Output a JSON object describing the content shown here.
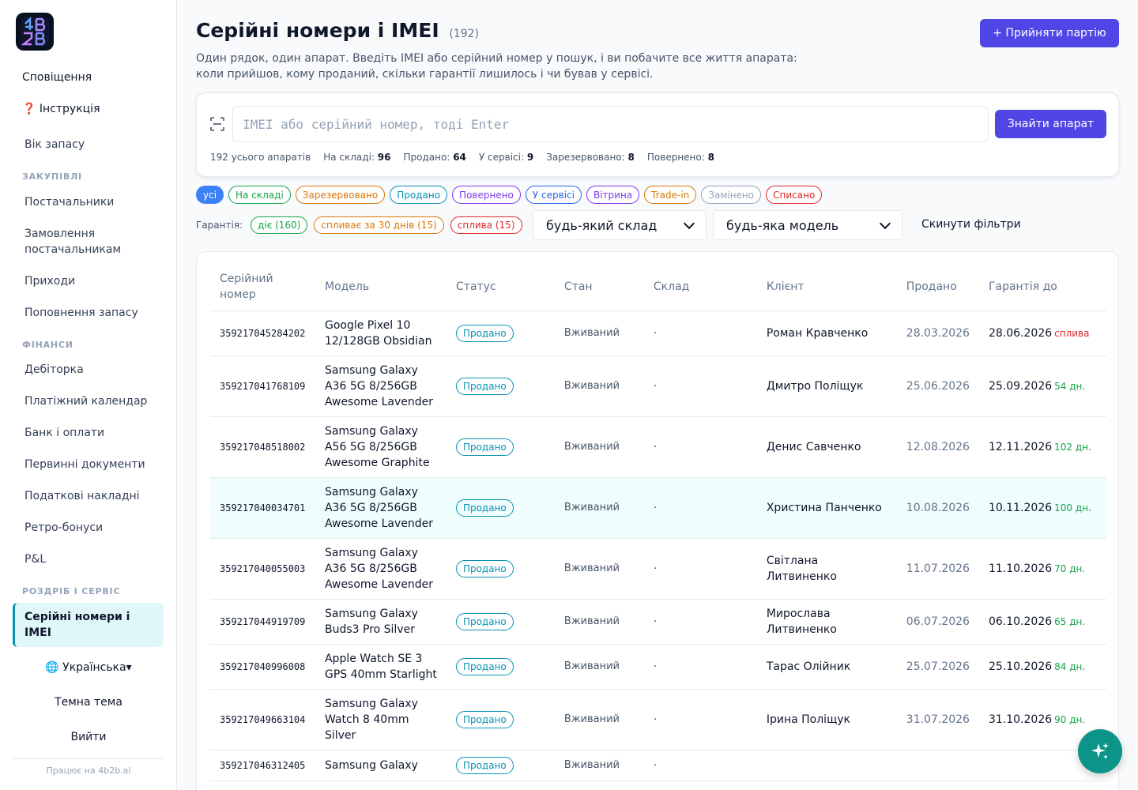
{
  "sidebar": {
    "logo_icon": "4b2b-logo",
    "notifications": "Сповіщення",
    "instructions": "❓ Інструкція",
    "stock_age": "Вік запасу",
    "section_purchases": "ЗАКУПІВЛІ",
    "suppliers": "Постачальники",
    "supplier_orders": "Замовлення постачальникам",
    "receipts": "Приходи",
    "replenishment": "Поповнення запасу",
    "section_finance": "ФІНАНСИ",
    "receivables": "Дебіторка",
    "payment_calendar": "Платіжний календар",
    "bank": "Банк і оплати",
    "documents": "Первинні документи",
    "tax_invoices": "Податкові накладні",
    "retro_bonuses": "Ретро-бонуси",
    "pnl": "P&L",
    "section_retail": "РОЗДРІБ І СЕРВІС",
    "serials_active": "Серійні номери і IMEI",
    "language": "🌐 Українська▾",
    "dark_theme": "Темна тема",
    "logout": "Вийти",
    "powered_by": "Працює на 4b2b.ai"
  },
  "header": {
    "title": "Серійні номери і IMEI",
    "count": "(192)",
    "subtitle_line1": "Один рядок, один апарат. Введіть IMEI або серійний номер у пошук, і ви побачите все життя апарата:",
    "subtitle_line2": "коли прийшов, кому проданий, скільки гарантії лишилось і чи бував у сервісі.",
    "accept_batch": "+ Прийняти партію"
  },
  "search": {
    "placeholder": "IMEI або серійний номер, тоді Enter",
    "value": "",
    "find_button": "Знайти апарат",
    "stats": {
      "total_text": "192 усього апаратів",
      "in_stock_label": "На складі:",
      "in_stock": "96",
      "sold_label": "Продано:",
      "sold": "64",
      "service_label": "У сервісі:",
      "service": "9",
      "reserved_label": "Зарезервовано:",
      "reserved": "8",
      "returned_label": "Повернено:",
      "returned": "8"
    }
  },
  "filters": {
    "status_chips": [
      {
        "label": "усі",
        "color": "#3b82f6",
        "active": true
      },
      {
        "label": "На складі",
        "color": "#16a34a",
        "active": false
      },
      {
        "label": "Зарезервовано",
        "color": "#d97706",
        "active": false
      },
      {
        "label": "Продано",
        "color": "#0891b2",
        "active": false
      },
      {
        "label": "Повернено",
        "color": "#7c3aed",
        "active": false
      },
      {
        "label": "У сервісі",
        "color": "#2563eb",
        "active": false
      },
      {
        "label": "Вітрина",
        "color": "#7c3aed",
        "active": false
      },
      {
        "label": "Trade-in",
        "color": "#d97706",
        "active": false
      },
      {
        "label": "Замінено",
        "color": "#94a3b8",
        "active": false
      },
      {
        "label": "Списано",
        "color": "#dc2626",
        "active": false
      }
    ],
    "warranty_label": "Гарантія:",
    "warranty_chips": [
      {
        "label": "діє (160)",
        "color": "#16a34a"
      },
      {
        "label": "спливає за 30 днів (15)",
        "color": "#d97706"
      },
      {
        "label": "сплива (15)",
        "color": "#dc2626"
      }
    ],
    "warehouse_select": "будь-який склад",
    "model_select": "будь-яка модель",
    "reset": "Скинути фільтри"
  },
  "table": {
    "columns": [
      "Серійний номер",
      "Модель",
      "Статус",
      "Стан",
      "Склад",
      "Клієнт",
      "Продано",
      "Гарантія до"
    ],
    "rows": [
      {
        "serial": "359217045284202",
        "model": "Google Pixel 10 12/128GB Obsidian",
        "status": "Продано",
        "condition": "Вживаний",
        "warehouse": "·",
        "client": "Роман Кравченко",
        "sold": "28.03.2026",
        "warranty": "28.06.2026",
        "note": "сплива",
        "note_color": "#dc2626",
        "highlight": false
      },
      {
        "serial": "359217041768109",
        "model": "Samsung Galaxy A36 5G 8/256GB Awesome Lavender",
        "status": "Продано",
        "condition": "Вживаний",
        "warehouse": "·",
        "client": "Дмитро Поліщук",
        "sold": "25.06.2026",
        "warranty": "25.09.2026",
        "note": "54 дн.",
        "note_color": "#16a34a",
        "highlight": false
      },
      {
        "serial": "359217048518002",
        "model": "Samsung Galaxy A56 5G 8/256GB Awesome Graphite",
        "status": "Продано",
        "condition": "Вживаний",
        "warehouse": "·",
        "client": "Денис Савченко",
        "sold": "12.08.2026",
        "warranty": "12.11.2026",
        "note": "102 дн.",
        "note_color": "#16a34a",
        "highlight": false
      },
      {
        "serial": "359217040034701",
        "model": "Samsung Galaxy A36 5G 8/256GB Awesome Lavender",
        "status": "Продано",
        "condition": "Вживаний",
        "warehouse": "·",
        "client": "Христина Панченко",
        "sold": "10.08.2026",
        "warranty": "10.11.2026",
        "note": "100 дн.",
        "note_color": "#16a34a",
        "highlight": true
      },
      {
        "serial": "359217040055003",
        "model": "Samsung Galaxy A36 5G 8/256GB Awesome Lavender",
        "status": "Продано",
        "condition": "Вживаний",
        "warehouse": "·",
        "client": "Світлана Литвиненко",
        "sold": "11.07.2026",
        "warranty": "11.10.2026",
        "note": "70 дн.",
        "note_color": "#16a34a",
        "highlight": false
      },
      {
        "serial": "359217044919709",
        "model": "Samsung Galaxy Buds3 Pro Silver",
        "status": "Продано",
        "condition": "Вживаний",
        "warehouse": "·",
        "client": "Мирослава Литвиненко",
        "sold": "06.07.2026",
        "warranty": "06.10.2026",
        "note": "65 дн.",
        "note_color": "#16a34a",
        "highlight": false
      },
      {
        "serial": "359217040996008",
        "model": "Apple Watch SE 3 GPS 40mm Starlight",
        "status": "Продано",
        "condition": "Вживаний",
        "warehouse": "·",
        "client": "Тарас Олійник",
        "sold": "25.07.2026",
        "warranty": "25.10.2026",
        "note": "84 дн.",
        "note_color": "#16a34a",
        "highlight": false
      },
      {
        "serial": "359217049663104",
        "model": "Samsung Galaxy Watch 8 40mm Silver",
        "status": "Продано",
        "condition": "Вживаний",
        "warehouse": "·",
        "client": "Ірина Поліщук",
        "sold": "31.07.2026",
        "warranty": "31.10.2026",
        "note": "90 дн.",
        "note_color": "#16a34a",
        "highlight": false
      },
      {
        "serial": "359217046312405",
        "model": "Samsung Galaxy",
        "status": "Продано",
        "condition": "Вживаний",
        "warehouse": "·",
        "client": "",
        "sold": "",
        "warranty": "",
        "note": "",
        "note_color": "#16a34a",
        "highlight": false
      }
    ]
  },
  "fab_icon": "sparkles-icon"
}
